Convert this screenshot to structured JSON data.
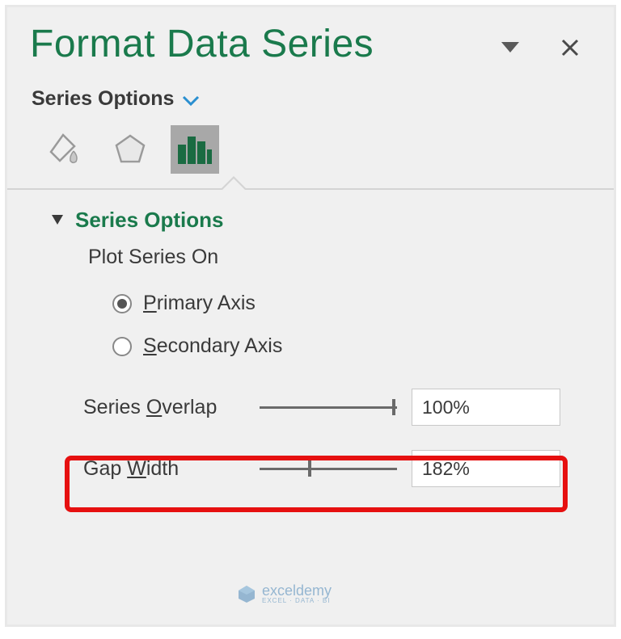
{
  "header": {
    "title": "Format Data Series"
  },
  "section_dropdown": "Series Options",
  "section_title": "Series Options",
  "plot_label": "Plot Series On",
  "radios": {
    "primary": "Primary Axis",
    "secondary": "Secondary Axis"
  },
  "controls": {
    "overlap_label": "Series Overlap",
    "overlap_value": "100%",
    "gap_label": "Gap Width",
    "gap_value": "182%"
  },
  "watermark": {
    "brand": "exceldemy",
    "sub": "EXCEL · DATA · BI"
  }
}
